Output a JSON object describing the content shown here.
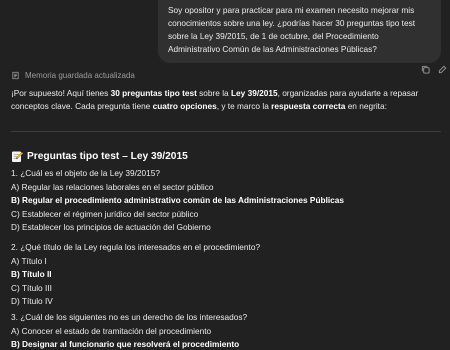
{
  "user_message": {
    "text": "Soy opositor y para practicar para mi examen necesito mejorar mis conocimientos sobre una ley. ¿podrías hacer 30 preguntas tipo test sobre la Ley 39/2015, de 1 de octubre, del Procedimiento Administrativo Común de las Administraciones Públicas?"
  },
  "memory_notice": "Memoria guardada actualizada",
  "intro": {
    "p1": "¡Por supuesto! Aquí tienes ",
    "b1": "30 preguntas tipo test",
    "p2": " sobre la ",
    "b2": "Ley 39/2015",
    "p3": ", organizadas para ayudarte a repasar conceptos clave. Cada pregunta tiene ",
    "b3": "cuatro opciones",
    "p4": ", y te marco la ",
    "b4": "respuesta correcta",
    "p5": " en negrita:"
  },
  "heading": "Preguntas tipo test – Ley 39/2015",
  "questions": [
    {
      "title": "1.  ¿Cuál es el objeto de la Ley 39/2015?",
      "options": [
        {
          "text": "A) Regular las relaciones laborales en el sector público",
          "correct": false
        },
        {
          "text": "B) Regular el procedimiento administrativo común de las Administraciones Públicas",
          "correct": true
        },
        {
          "text": "C) Establecer el régimen jurídico del sector público",
          "correct": false
        },
        {
          "text": "D) Establecer los principios de actuación del Gobierno",
          "correct": false
        }
      ]
    },
    {
      "title": "2.  ¿Qué título de la Ley regula los interesados en el procedimiento?",
      "options": [
        {
          "text": "A) Título I",
          "correct": false
        },
        {
          "text": "B) Título II",
          "correct": true
        },
        {
          "text": "C) Título III",
          "correct": false
        },
        {
          "text": "D) Título IV",
          "correct": false
        }
      ]
    },
    {
      "title": "3.  ¿Cuál de los siguientes no es un derecho de los interesados?",
      "options": [
        {
          "text": "A) Conocer el estado de tramitación del procedimiento",
          "correct": false
        },
        {
          "text": "B) Designar al funcionario que resolverá el procedimiento",
          "correct": true
        }
      ]
    }
  ]
}
